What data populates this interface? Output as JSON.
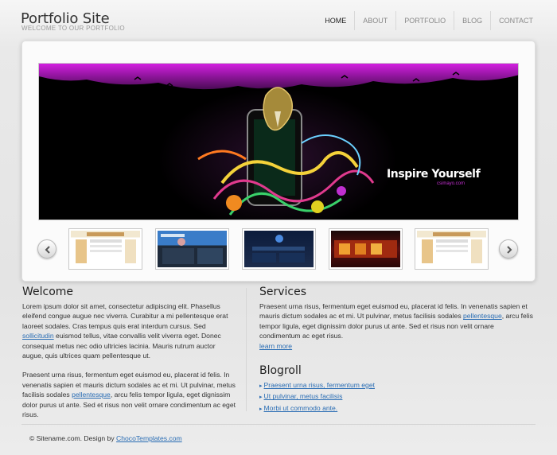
{
  "header": {
    "title": "Portfolio Site",
    "subtitle": "WELCOME TO OUR PORTFOLIO"
  },
  "nav": {
    "items": [
      {
        "label": "HOME",
        "active": true
      },
      {
        "label": "ABOUT",
        "active": false
      },
      {
        "label": "PORTFOLIO",
        "active": false
      },
      {
        "label": "BLOG",
        "active": false
      },
      {
        "label": "CONTACT",
        "active": false
      }
    ]
  },
  "slider": {
    "banner_heading": "Inspire Yourself",
    "banner_subtext": "csimayo.com",
    "prev_icon": "chevron-left-icon",
    "next_icon": "chevron-right-icon",
    "thumbnail_count": 5
  },
  "welcome": {
    "heading": "Welcome",
    "p1_before_link": "Lorem ipsum dolor sit amet, consectetur adipiscing elit. Phasellus eleifend congue augue nec viverra. Curabitur a mi pellentesque erat laoreet sodales. Cras tempus quis erat interdum cursus. Sed ",
    "p1_link": "sollicitudin",
    "p1_after_link": " euismod tellus, vitae convallis velit viverra eget. Donec consequat metus nec odio ultricies lacinia. Mauris rutrum auctor augue, quis ultrices quam pellentesque ut.",
    "p2_before_link": "Praesent urna risus, fermentum eget euismod eu, placerat id felis. In venenatis sapien et mauris dictum sodales ac et mi. Ut pulvinar, metus facilisis sodales ",
    "p2_link": "pellentesque",
    "p2_after_link": ", arcu felis tempor ligula, eget dignissim dolor purus ut ante. Sed et risus non velit ornare condimentum ac eget risus."
  },
  "services": {
    "heading": "Services",
    "text_before_link": "Praesent urna risus, fermentum eget euismod eu, placerat id felis. In venenatis sapien et mauris dictum sodales ac et mi. Ut pulvinar, metus facilisis sodales ",
    "text_link": "pellentesque",
    "text_after_link": ", arcu felis tempor ligula, eget dignissim dolor purus ut ante. Sed et risus non velit ornare condimentum ac eget risus.",
    "learn_more": "learn more"
  },
  "blogroll": {
    "heading": "Blogroll",
    "items": [
      "Praesent urna risus, fermentum eget",
      "Ut pulvinar, metus facilisis",
      "Morbi ut commodo ante."
    ]
  },
  "footer": {
    "text": "© Sitename.com. Design by ",
    "link": "ChocoTemplates.com"
  },
  "colors": {
    "link": "#2a6db4",
    "banner_magenta": "#c01fd0",
    "banner_bg": "#000000"
  }
}
